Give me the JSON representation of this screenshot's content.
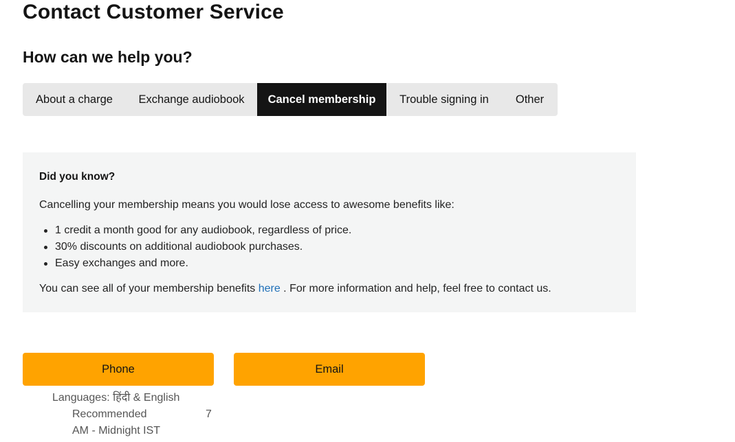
{
  "header": {
    "title": "Contact Customer Service",
    "subtitle": "How can we help you?"
  },
  "tabs": [
    {
      "label": "About a charge",
      "active": false
    },
    {
      "label": "Exchange audiobook",
      "active": false
    },
    {
      "label": "Cancel membership",
      "active": true
    },
    {
      "label": "Trouble signing in",
      "active": false
    },
    {
      "label": "Other",
      "active": false
    }
  ],
  "info": {
    "heading": "Did you know?",
    "intro": "Cancelling your membership means you would lose access to awesome benefits like:",
    "benefits": [
      "1 credit a month good for any audiobook, regardless of price.",
      "30% discounts on additional audiobook purchases.",
      "Easy exchanges and more."
    ],
    "footer_before": "You can see all of your membership benefits ",
    "footer_link": "here",
    "footer_after": " . For more information and help, feel free to contact us."
  },
  "contact": {
    "phone_label": "Phone",
    "email_label": "Email",
    "languages": "Languages: हिंदी & English",
    "recommended": "Recommended",
    "hours_start": "7",
    "hours_end": "AM - Midnight IST"
  },
  "colors": {
    "accent": "#ffa300",
    "active_tab": "#141414",
    "tab_bg": "#e8e8e8",
    "info_bg": "#f4f5f5",
    "link": "#1e6fb8"
  }
}
